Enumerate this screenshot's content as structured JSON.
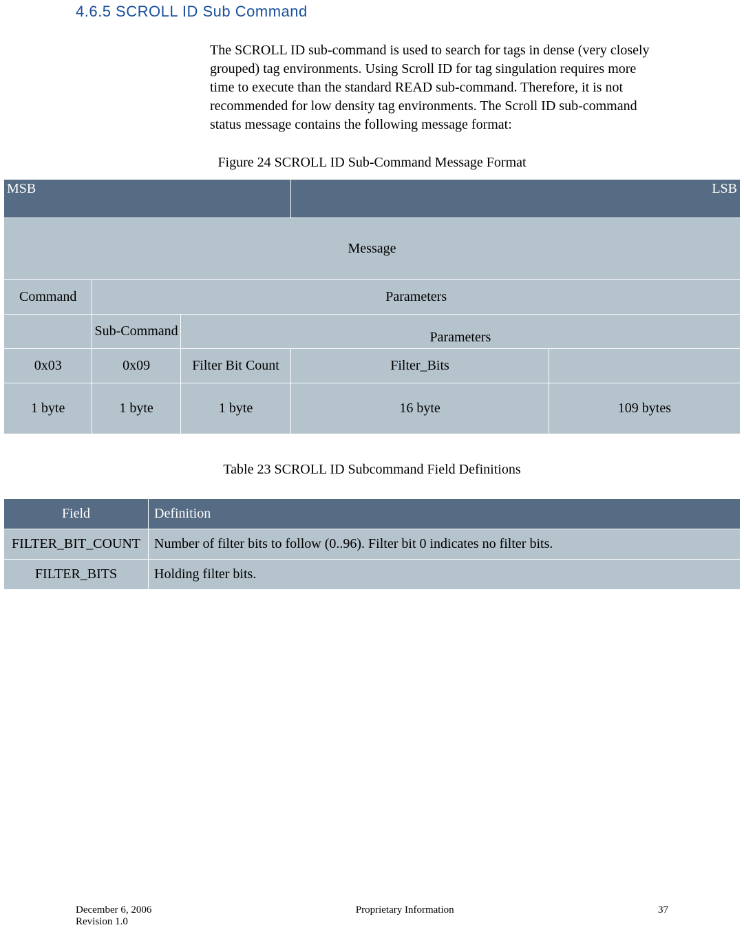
{
  "heading": "4.6.5 SCROLL ID Sub Command",
  "paragraph": "The SCROLL ID sub-command is used to search for tags in dense (very closely grouped) tag environments.  Using Scroll ID for tag singulation requires more time to execute than the standard READ sub-command.  Therefore, it is not recommended for low density tag environments.  The Scroll ID sub-command status message contains the following message format:",
  "figure_caption": "Figure 24 SCROLL ID  Sub-Command Message Format",
  "msb_label": "MSB",
  "lsb_label": "LSB",
  "row1": {
    "message": "Message"
  },
  "row2": {
    "command": "Command",
    "parameters": "Parameters"
  },
  "row3": {
    "empty": "",
    "sub_command": "Sub-Command",
    "parameters": "Parameters"
  },
  "row4": {
    "c1": "0x03",
    "c2": "0x09",
    "c3": "Filter Bit Count",
    "c4": "Filter_Bits",
    "c5": ""
  },
  "row5": {
    "c1": "1 byte",
    "c2": "1 byte",
    "c3": "1 byte",
    "c4": "16 byte",
    "c5": "109 bytes"
  },
  "table_caption": "Table 23 SCROLL ID Subcommand Field Definitions",
  "def_headers": {
    "field": "Field",
    "definition": "Definition"
  },
  "def_rows": [
    {
      "field": "FILTER_BIT_COUNT",
      "definition": "Number of filter bits to follow (0..96). Filter bit 0 indicates no filter bits."
    },
    {
      "field": "FILTER_BITS",
      "definition": "Holding filter bits."
    }
  ],
  "footer": {
    "date": "December 6, 2006",
    "center": "Proprietary Information",
    "page": "37",
    "revision": "Revision 1.0"
  }
}
